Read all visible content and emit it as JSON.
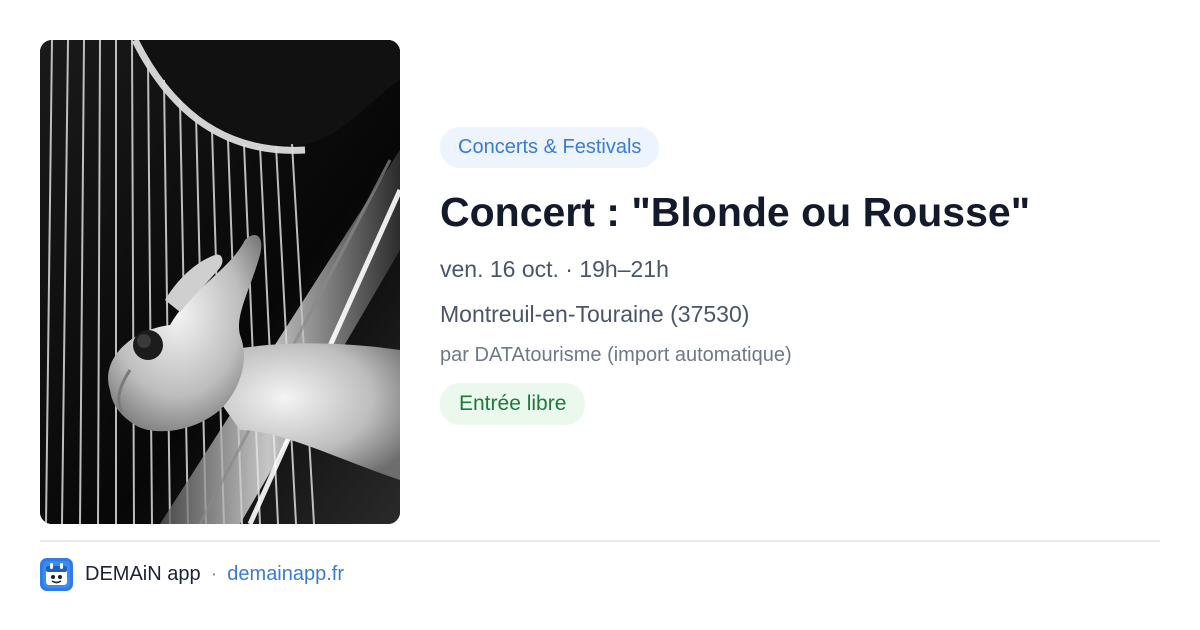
{
  "event": {
    "category": "Concerts & Festivals",
    "title": "Concert : \"Blonde ou Rousse\"",
    "datetime": "ven. 16 oct. · 19h–21h",
    "location": "Montreuil-en-Touraine (37530)",
    "source": "par DATAtourisme (import automatique)",
    "price": "Entrée libre"
  },
  "footer": {
    "app_name": "DEMAiN app",
    "separator": "·",
    "link": "demainapp.fr"
  },
  "colors": {
    "accent_blue": "#3a7bd5",
    "badge_blue_bg": "#eef4fd",
    "badge_green_bg": "#ebf8ee",
    "badge_green_text": "#1e7a3a",
    "title": "#121a2c"
  },
  "icons": {
    "photo": "harp-photo",
    "logo": "demain-app-logo-icon"
  }
}
